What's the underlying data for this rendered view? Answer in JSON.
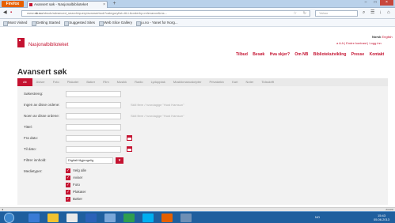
{
  "browser": {
    "app_button": "Firefox",
    "tab_title": "Avansert søk - Nasjonalbiblioteket",
    "url_prefix": "www.",
    "url_host": "nb.no",
    "url_rest": "/nbsok/advanced_search/query/avansertsok?categorylist=ALL&orderby=relevance&ms...",
    "search_placeholder": "Yahoo",
    "bookmarks": [
      "Most Visited",
      "Getting Started",
      "Suggested Sites",
      "Web Slice Gallery",
      "ju.no - Yanet for Norg..."
    ]
  },
  "site": {
    "brand": "Nasjonalbiblioteket",
    "login_prefix": "Norsk",
    "login_link": "English",
    "user_bar": "a A A | Endre kontrast | Logg inn",
    "nav": [
      "Tilbud",
      "Besøk",
      "Hva skjer?",
      "Om NB",
      "Bibliotekutvikling",
      "Presse",
      "Kontakt"
    ]
  },
  "search": {
    "heading": "Avansert søk",
    "categories": [
      "Alt",
      "Aviser",
      "Foto",
      "Plakater",
      "Bøker",
      "Film",
      "Musikk",
      "Radio",
      "Lydopptak",
      "Musikkmanuskripter",
      "Privatarkiv",
      "Kart",
      "Noter",
      "Tidsskrift"
    ],
    "active_category": "Alt",
    "fields": [
      {
        "label": "Søkestreng:",
        "value": "",
        "hint": ""
      },
      {
        "label": "Ingen av disse ordene:",
        "value": "",
        "hint": "Skill flere / hvordagige \"Hust Hamsun\""
      },
      {
        "label": "Noen av disse ordene:",
        "value": "",
        "hint": "Skill flere / hvordagige \"Hust Hamsun\""
      },
      {
        "label": "Tittel:",
        "value": "",
        "hint": ""
      },
      {
        "label": "Fra dato:",
        "value": "",
        "hint": ""
      },
      {
        "label": "Til dato:",
        "value": "",
        "hint": ""
      }
    ],
    "access_label": "Filtrer innhold:",
    "access_value": "Digitalt tilgjengelig",
    "media_label": "Medietyper:",
    "media_types": [
      "Velg alle",
      "Aviser",
      "Foto",
      "Plakater",
      "Bøker",
      "Film"
    ]
  },
  "system": {
    "tray": "NO",
    "time": "15:43",
    "date": "05.06.2013",
    "corner_label": "zoom"
  }
}
